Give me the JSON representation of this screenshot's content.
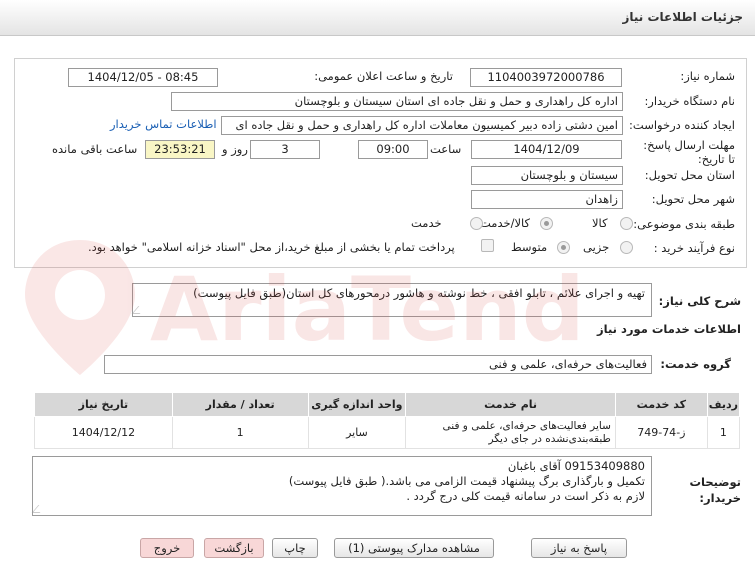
{
  "header": {
    "title": "جزئیات اطلاعات نیاز"
  },
  "form": {
    "need_number_label": "شماره نیاز:",
    "need_number": "1104003972000786",
    "announce_label": "تاریخ و ساعت اعلان عمومی:",
    "announce_value": "1404/12/05 - 08:45",
    "buyer_org_label": "نام دستگاه خریدار:",
    "buyer_org": "اداره کل راهداری و حمل و نقل جاده ای استان سیستان و بلوچستان",
    "requester_label": "ایجاد کننده درخواست:",
    "requester": "امین دشتی زاده دبیر کمیسیون معاملات اداره کل راهداری و حمل و نقل جاده ای",
    "contact_link": "اطلاعات تماس خریدار",
    "deadline_label": "مهلت ارسال پاسخ: تا تاریخ:",
    "deadline_date": "1404/12/09",
    "time_label": "ساعت",
    "deadline_time": "09:00",
    "days_value": "3",
    "days_label": "روز و",
    "remaining_time": "23:53:21",
    "remaining_label": "ساعت باقی مانده",
    "province_label": "استان محل تحویل:",
    "province": "سیستان و بلوچستان",
    "city_label": "شهر محل تحویل:",
    "city": "زاهدان",
    "category_label": "طبقه بندی موضوعی:",
    "category_options": [
      "کالا",
      "کالا/خدمت",
      "خدمت"
    ],
    "process_label": "نوع فرآیند خرید :",
    "process_options": [
      "جزیی",
      "متوسط"
    ],
    "payment_note": "پرداخت تمام یا بخشی از مبلغ خرید،از محل \"اسناد خزانه اسلامی\" خواهد بود."
  },
  "description": {
    "label": "شرح کلی نیاز:",
    "value": "تهیه و اجرای علائم ، تابلو افقی ، خط نوشته و هاشور درمحورهای کل استان(طبق فایل پیوست)"
  },
  "services": {
    "section_title": "اطلاعات خدمات مورد نیاز",
    "group_label": "گروه خدمت:",
    "group_value": "فعالیت‌های حرفه‌ای، علمی و فنی"
  },
  "table": {
    "headers": [
      "ردیف",
      "کد خدمت",
      "نام خدمت",
      "واحد اندازه گیری",
      "تعداد / مقدار",
      "تاریخ نیاز"
    ],
    "rows": [
      [
        "1",
        "ز-74-749",
        "سایر فعالیت‌های حرفه‌ای، علمی و فنی طبقه‌بندی‌نشده در جای دیگر",
        "سایر",
        "1",
        "1404/12/12"
      ]
    ]
  },
  "notes": {
    "label": "توضیحات خریدار:",
    "lines": [
      "09153409880 آقای باغبان",
      "تکمیل و بارگذاری برگ پیشنهاد قیمت الزامی می باشد.( طبق فایل پیوست)",
      "لازم به ذکر است در سامانه قیمت کلی درج گردد ."
    ]
  },
  "buttons": {
    "reply": "پاسخ به نیاز",
    "view_docs": "مشاهده مدارک پیوستی (1)",
    "print": "چاپ",
    "back": "بازگشت",
    "exit": "خروج"
  },
  "watermark": {
    "text": "AriaTender.net",
    "color": "#d9534f"
  }
}
